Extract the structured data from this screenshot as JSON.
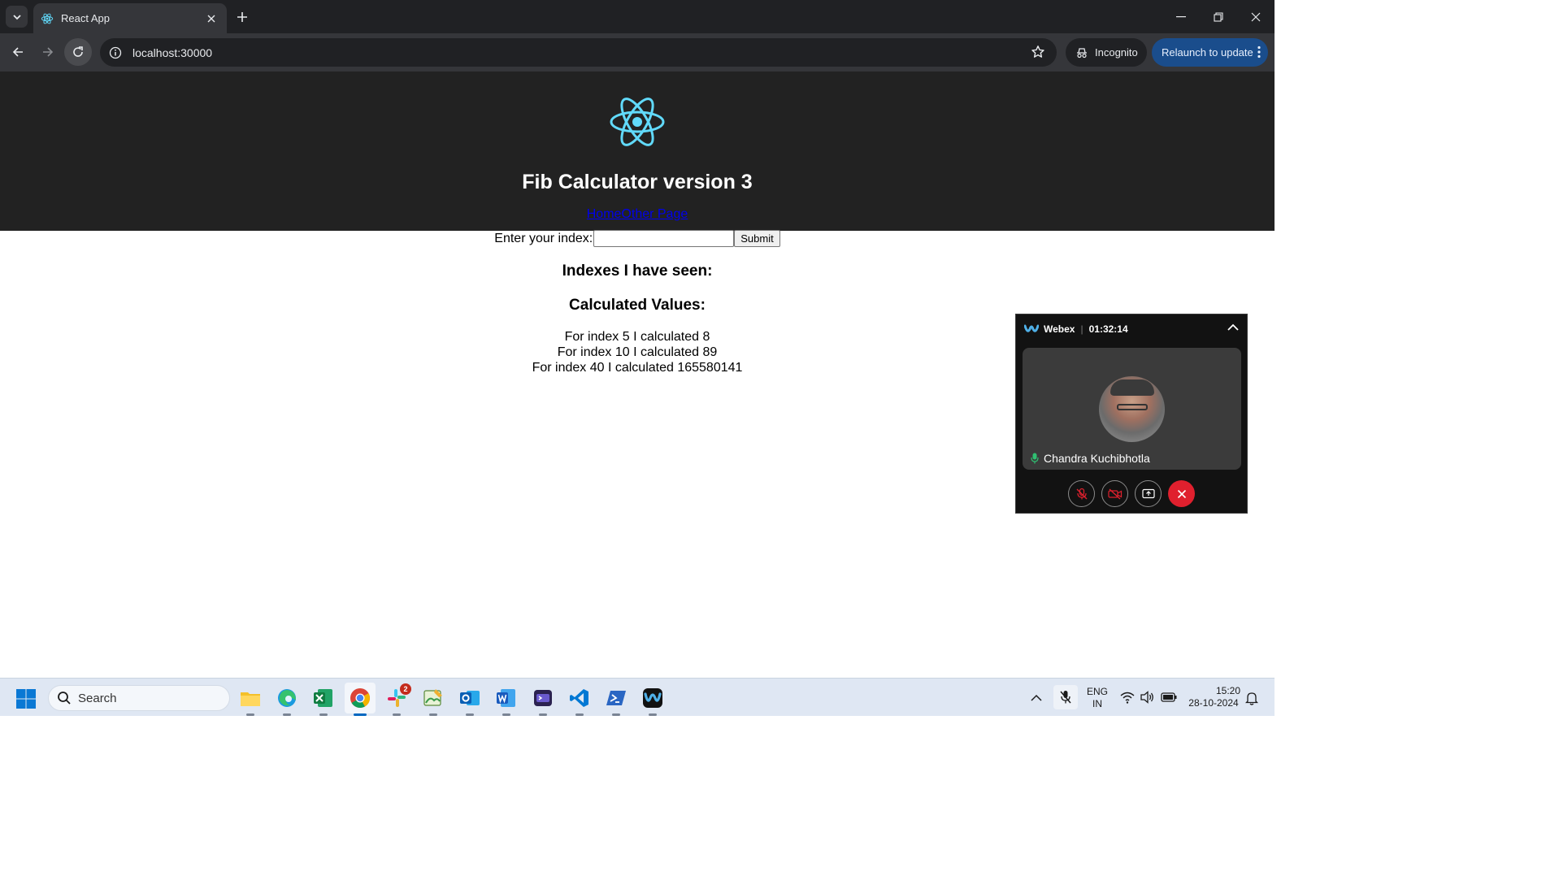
{
  "browser": {
    "tab_title": "React App",
    "url": "localhost:30000",
    "incognito_label": "Incognito",
    "relaunch_label": "Relaunch to update"
  },
  "app": {
    "title": "Fib Calculator version 3",
    "nav": {
      "home": "Home",
      "other": "Other Page"
    },
    "form": {
      "label": "Enter your index:",
      "input_value": "",
      "submit_label": "Submit"
    },
    "indexes_heading": "Indexes I have seen:",
    "values_heading": "Calculated Values:",
    "values": [
      "For index 5 I calculated 8",
      "For index 10 I calculated 89",
      "For index 40 I calculated 165580141"
    ]
  },
  "webex": {
    "app_name": "Webex",
    "timer": "01:32:14",
    "participant": "Chandra Kuchibhotla"
  },
  "taskbar": {
    "search_placeholder": "Search",
    "slack_badge": "2",
    "lang_line1": "ENG",
    "lang_line2": "IN",
    "time": "15:20",
    "date": "28-10-2024"
  },
  "colors": {
    "header_bg": "#222222",
    "react_blue": "#61dafb",
    "link": "#0000ee",
    "webex_end": "#e0202e"
  }
}
